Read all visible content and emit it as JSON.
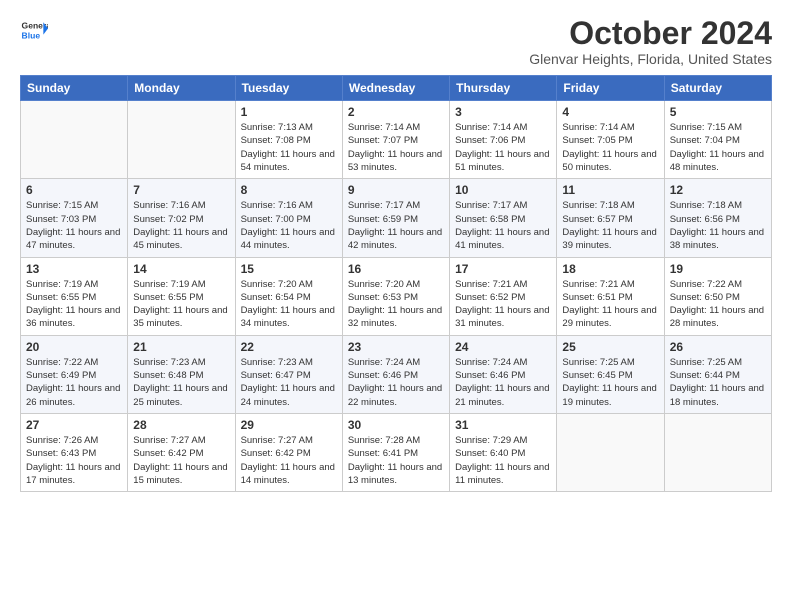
{
  "header": {
    "logo_line1": "General",
    "logo_line2": "Blue",
    "month": "October 2024",
    "location": "Glenvar Heights, Florida, United States"
  },
  "weekdays": [
    "Sunday",
    "Monday",
    "Tuesday",
    "Wednesday",
    "Thursday",
    "Friday",
    "Saturday"
  ],
  "weeks": [
    [
      {
        "day": "",
        "info": ""
      },
      {
        "day": "",
        "info": ""
      },
      {
        "day": "1",
        "info": "Sunrise: 7:13 AM\nSunset: 7:08 PM\nDaylight: 11 hours and 54 minutes."
      },
      {
        "day": "2",
        "info": "Sunrise: 7:14 AM\nSunset: 7:07 PM\nDaylight: 11 hours and 53 minutes."
      },
      {
        "day": "3",
        "info": "Sunrise: 7:14 AM\nSunset: 7:06 PM\nDaylight: 11 hours and 51 minutes."
      },
      {
        "day": "4",
        "info": "Sunrise: 7:14 AM\nSunset: 7:05 PM\nDaylight: 11 hours and 50 minutes."
      },
      {
        "day": "5",
        "info": "Sunrise: 7:15 AM\nSunset: 7:04 PM\nDaylight: 11 hours and 48 minutes."
      }
    ],
    [
      {
        "day": "6",
        "info": "Sunrise: 7:15 AM\nSunset: 7:03 PM\nDaylight: 11 hours and 47 minutes."
      },
      {
        "day": "7",
        "info": "Sunrise: 7:16 AM\nSunset: 7:02 PM\nDaylight: 11 hours and 45 minutes."
      },
      {
        "day": "8",
        "info": "Sunrise: 7:16 AM\nSunset: 7:00 PM\nDaylight: 11 hours and 44 minutes."
      },
      {
        "day": "9",
        "info": "Sunrise: 7:17 AM\nSunset: 6:59 PM\nDaylight: 11 hours and 42 minutes."
      },
      {
        "day": "10",
        "info": "Sunrise: 7:17 AM\nSunset: 6:58 PM\nDaylight: 11 hours and 41 minutes."
      },
      {
        "day": "11",
        "info": "Sunrise: 7:18 AM\nSunset: 6:57 PM\nDaylight: 11 hours and 39 minutes."
      },
      {
        "day": "12",
        "info": "Sunrise: 7:18 AM\nSunset: 6:56 PM\nDaylight: 11 hours and 38 minutes."
      }
    ],
    [
      {
        "day": "13",
        "info": "Sunrise: 7:19 AM\nSunset: 6:55 PM\nDaylight: 11 hours and 36 minutes."
      },
      {
        "day": "14",
        "info": "Sunrise: 7:19 AM\nSunset: 6:55 PM\nDaylight: 11 hours and 35 minutes."
      },
      {
        "day": "15",
        "info": "Sunrise: 7:20 AM\nSunset: 6:54 PM\nDaylight: 11 hours and 34 minutes."
      },
      {
        "day": "16",
        "info": "Sunrise: 7:20 AM\nSunset: 6:53 PM\nDaylight: 11 hours and 32 minutes."
      },
      {
        "day": "17",
        "info": "Sunrise: 7:21 AM\nSunset: 6:52 PM\nDaylight: 11 hours and 31 minutes."
      },
      {
        "day": "18",
        "info": "Sunrise: 7:21 AM\nSunset: 6:51 PM\nDaylight: 11 hours and 29 minutes."
      },
      {
        "day": "19",
        "info": "Sunrise: 7:22 AM\nSunset: 6:50 PM\nDaylight: 11 hours and 28 minutes."
      }
    ],
    [
      {
        "day": "20",
        "info": "Sunrise: 7:22 AM\nSunset: 6:49 PM\nDaylight: 11 hours and 26 minutes."
      },
      {
        "day": "21",
        "info": "Sunrise: 7:23 AM\nSunset: 6:48 PM\nDaylight: 11 hours and 25 minutes."
      },
      {
        "day": "22",
        "info": "Sunrise: 7:23 AM\nSunset: 6:47 PM\nDaylight: 11 hours and 24 minutes."
      },
      {
        "day": "23",
        "info": "Sunrise: 7:24 AM\nSunset: 6:46 PM\nDaylight: 11 hours and 22 minutes."
      },
      {
        "day": "24",
        "info": "Sunrise: 7:24 AM\nSunset: 6:46 PM\nDaylight: 11 hours and 21 minutes."
      },
      {
        "day": "25",
        "info": "Sunrise: 7:25 AM\nSunset: 6:45 PM\nDaylight: 11 hours and 19 minutes."
      },
      {
        "day": "26",
        "info": "Sunrise: 7:25 AM\nSunset: 6:44 PM\nDaylight: 11 hours and 18 minutes."
      }
    ],
    [
      {
        "day": "27",
        "info": "Sunrise: 7:26 AM\nSunset: 6:43 PM\nDaylight: 11 hours and 17 minutes."
      },
      {
        "day": "28",
        "info": "Sunrise: 7:27 AM\nSunset: 6:42 PM\nDaylight: 11 hours and 15 minutes."
      },
      {
        "day": "29",
        "info": "Sunrise: 7:27 AM\nSunset: 6:42 PM\nDaylight: 11 hours and 14 minutes."
      },
      {
        "day": "30",
        "info": "Sunrise: 7:28 AM\nSunset: 6:41 PM\nDaylight: 11 hours and 13 minutes."
      },
      {
        "day": "31",
        "info": "Sunrise: 7:29 AM\nSunset: 6:40 PM\nDaylight: 11 hours and 11 minutes."
      },
      {
        "day": "",
        "info": ""
      },
      {
        "day": "",
        "info": ""
      }
    ]
  ]
}
